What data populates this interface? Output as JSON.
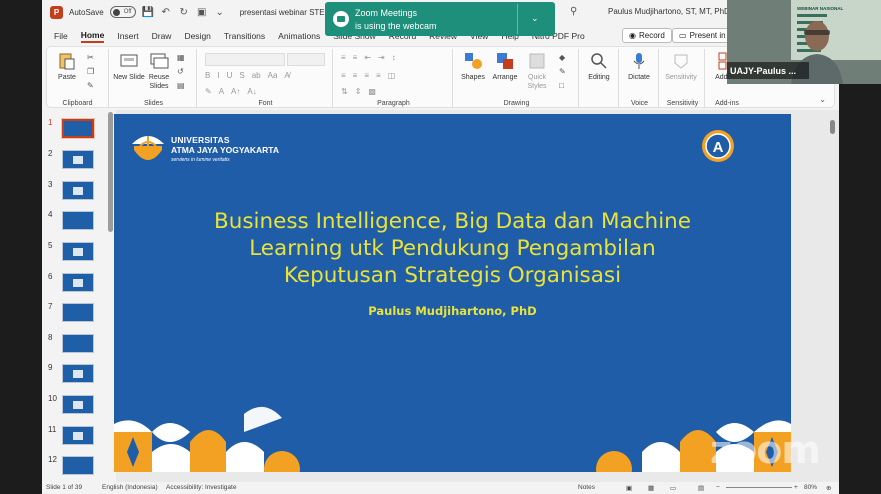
{
  "titlebar": {
    "autosave_label": "AutoSave",
    "toggle_state": "Off",
    "document_title": "presentasi webinar STEKO",
    "user_name": "Paulus  Mudjihartono, ST, MT, PhD"
  },
  "tabs": [
    "File",
    "Home",
    "Insert",
    "Draw",
    "Design",
    "Transitions",
    "Animations",
    "Slide Show",
    "Record",
    "Review",
    "View",
    "Help",
    "Nitro PDF Pro"
  ],
  "tab_buttons": {
    "record": "Record",
    "present": "Present in T"
  },
  "ribbon": {
    "clipboard": {
      "paste": "Paste",
      "label": "Clipboard"
    },
    "slides": {
      "new_slide": "New Slide",
      "reuse_slides": "Reuse Slides",
      "label": "Slides"
    },
    "font": {
      "label": "Font"
    },
    "paragraph": {
      "label": "Paragraph"
    },
    "drawing": {
      "shapes": "Shapes",
      "arrange": "Arrange",
      "quick_styles": "Quick Styles",
      "label": "Drawing"
    },
    "editing": {
      "editing": "Editing"
    },
    "voice": {
      "dictate": "Dictate",
      "label": "Voice"
    },
    "sensitivity": {
      "sensitivity": "Sensitivity",
      "label": "Sensitivity"
    },
    "addins": {
      "addins": "Add-ins",
      "label": "Add-ins"
    }
  },
  "thumbnails": [
    {
      "num": "1"
    },
    {
      "num": "2"
    },
    {
      "num": "3"
    },
    {
      "num": "4"
    },
    {
      "num": "5"
    },
    {
      "num": "6"
    },
    {
      "num": "7"
    },
    {
      "num": "8"
    },
    {
      "num": "9"
    },
    {
      "num": "10"
    },
    {
      "num": "11"
    },
    {
      "num": "12"
    }
  ],
  "slide": {
    "uni_line1": "UNIVERSITAS",
    "uni_line2": "ATMA JAYA YOGYAKARTA",
    "uni_line3": "serviens in lumine veritatis",
    "badge_letter": "A",
    "title_line1": "Business Intelligence, Big Data dan Machine",
    "title_line2": "Learning utk Pendukung Pengambilan",
    "title_line3": "Keputusan Strategis Organisasi",
    "author": "Paulus Mudjihartono, PhD",
    "bg_color": "#1f5da8",
    "text_color": "#e8e23a",
    "accent_orange": "#f2a122"
  },
  "statusbar": {
    "slide_count": "Slide 1 of 39",
    "language": "English (Indonesia)",
    "accessibility": "Accessibility: Investigate",
    "notes": "Notes",
    "zoom": "80%"
  },
  "toast": {
    "title": "Zoom Meetings",
    "message": "is using the webcam"
  },
  "webcam": {
    "participant_name": "UAJY-Paulus ...",
    "banner_title": "WEBINAR NASIONAL"
  },
  "watermark": "zoom"
}
